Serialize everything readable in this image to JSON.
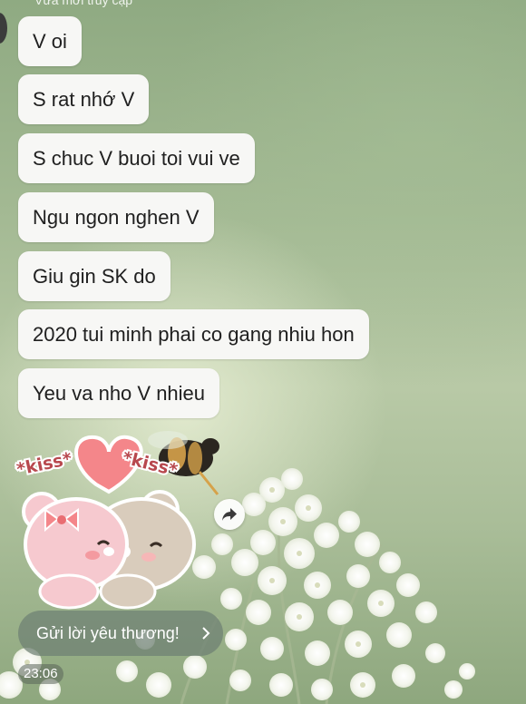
{
  "chat": {
    "status_text": "Vừa mới truy cập",
    "messages": [
      "V oi",
      "S rat nhớ V",
      "S chuc V buoi toi vui ve",
      "Ngu ngon nghen V",
      "Giu gin SK do",
      "2020 tui minh phai co gang nhiu hon",
      "Yeu va nho V nhieu"
    ],
    "sticker": {
      "left_text": "*kiss*",
      "right_text": "*kiss*",
      "icon": "kissing-bears-sticker"
    },
    "share_icon": "share-arrow-icon",
    "love_button_label": "Gửi lời yêu thương!",
    "timestamp": "23:06"
  },
  "colors": {
    "bubble": "#f7f7f5",
    "text": "#202020",
    "heart": "#f4868a",
    "pink_bear": "#f6c9cf",
    "tan_bear": "#d9ccbc"
  }
}
